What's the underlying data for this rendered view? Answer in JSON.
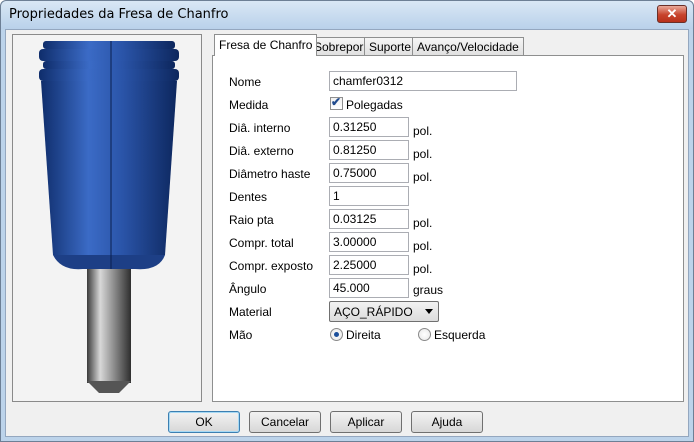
{
  "window": {
    "title": "Propriedades da Fresa de Chanfro",
    "close_label": "✕"
  },
  "tabs": [
    {
      "label": "Fresa de Chanfro",
      "active": true
    },
    {
      "label": "Sobrepor",
      "active": false
    },
    {
      "label": "Suporte",
      "active": false
    },
    {
      "label": "Avanço/Velocidade",
      "active": false
    }
  ],
  "form": {
    "name": {
      "label": "Nome",
      "value": "chamfer0312"
    },
    "measure": {
      "label": "Medida",
      "checkbox_label": "Polegadas",
      "checked": true
    },
    "inner_diameter": {
      "label": "Diâ. interno",
      "value": "0.31250",
      "unit": "pol."
    },
    "outer_diameter": {
      "label": "Diâ. externo",
      "value": "0.81250",
      "unit": "pol."
    },
    "shank_diameter": {
      "label": "Diâmetro haste",
      "value": "0.75000",
      "unit": "pol."
    },
    "teeth": {
      "label": "Dentes",
      "value": "1"
    },
    "tip_radius": {
      "label": "Raio pta",
      "value": "0.03125",
      "unit": "pol."
    },
    "total_length": {
      "label": "Compr. total",
      "value": "3.00000",
      "unit": "pol."
    },
    "exposed_length": {
      "label": "Compr. exposto",
      "value": "2.25000",
      "unit": "pol."
    },
    "angle": {
      "label": "Ângulo",
      "value": "45.000",
      "unit": "graus"
    },
    "material": {
      "label": "Material",
      "value": "AÇO_RÁPIDO"
    },
    "hand": {
      "label": "Mão",
      "right_label": "Direita",
      "left_label": "Esquerda",
      "selected": "Direita"
    }
  },
  "buttons": {
    "ok": "OK",
    "cancel": "Cancelar",
    "apply": "Aplicar",
    "help": "Ajuda"
  },
  "colors": {
    "tool_body": "#2a54a8",
    "shank": "#8c8c8c",
    "window_frame": "#bcd3ea"
  },
  "icons": {
    "close": "close-icon",
    "dropdown": "chevron-down-icon",
    "check": "check-icon"
  }
}
